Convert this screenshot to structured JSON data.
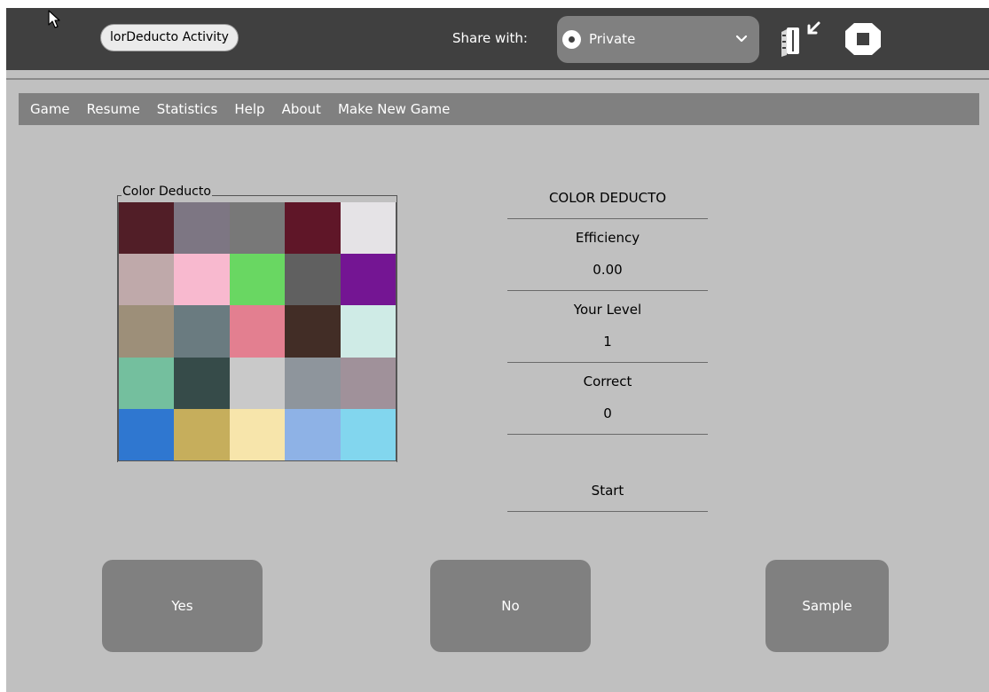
{
  "toolbar": {
    "activity_title": "lorDeducto Activity",
    "share_label": "Share with:",
    "share_value": "Private",
    "keep_icon": "journal-keep-icon",
    "stop_icon": "stop-icon"
  },
  "menu": {
    "items": [
      "Game",
      "Resume",
      "Statistics",
      "Help",
      "About",
      "Make New Game"
    ]
  },
  "grid": {
    "label": "Color Deducto",
    "colors": [
      "#511e27",
      "#7d7683",
      "#787878",
      "#5f1628",
      "#e5e3e6",
      "#bfa9aa",
      "#f8b9cf",
      "#69d762",
      "#606060",
      "#741593",
      "#9d8f79",
      "#6a7b80",
      "#e37f90",
      "#422d26",
      "#cfebe6",
      "#74bf9e",
      "#364b49",
      "#c9c9c9",
      "#8e959c",
      "#a0919a",
      "#2f77d0",
      "#c6ae5c",
      "#f7e5ab",
      "#8eb2e6",
      "#82d6ee"
    ]
  },
  "stats": {
    "title": "COLOR DEDUCTO",
    "efficiency_label": "Efficiency",
    "efficiency_value": "0.00",
    "level_label": "Your Level",
    "level_value": "1",
    "correct_label": "Correct",
    "correct_value": "0",
    "start_label": "Start"
  },
  "buttons": {
    "yes": "Yes",
    "no": "No",
    "sample": "Sample"
  },
  "colors": {
    "toolbar_bg": "#404040",
    "window_bg": "#c0c0c0",
    "button_bg": "#808080"
  }
}
